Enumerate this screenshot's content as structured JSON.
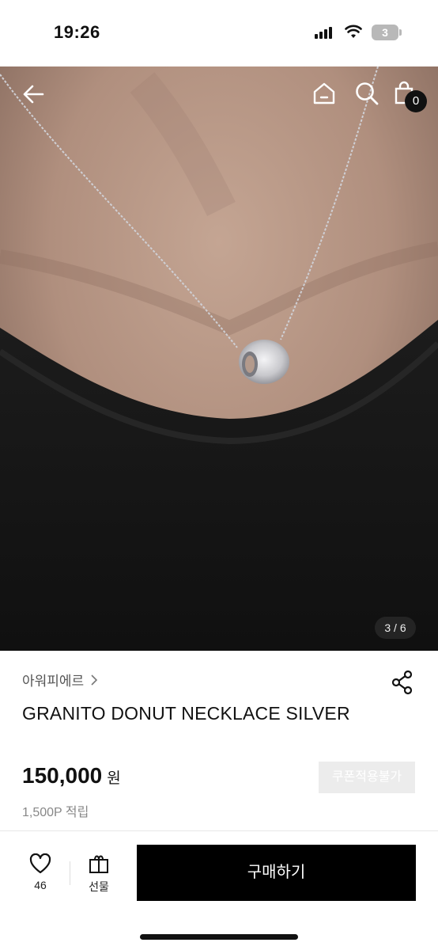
{
  "status_bar": {
    "time": "19:26",
    "battery_level": "3"
  },
  "nav": {
    "back_icon": "arrow-left-icon",
    "home_icon": "home-icon",
    "search_icon": "search-icon",
    "cart_icon": "shopping-bag-icon",
    "cart_count": "0"
  },
  "gallery": {
    "indicator": "3 / 6"
  },
  "product": {
    "brand": "아워피에르",
    "title": "GRANITO DONUT NECKLACE SILVER",
    "price": "150,000",
    "currency": "원",
    "coupon_label": "쿠폰적용불가",
    "points": "1,500P 적립"
  },
  "bottom_bar": {
    "like_count": "46",
    "gift_label": "선물",
    "buy_label": "구매하기"
  },
  "colors": {
    "primary": "#000000",
    "muted_text": "#888888",
    "coupon_bg": "#ececec"
  }
}
